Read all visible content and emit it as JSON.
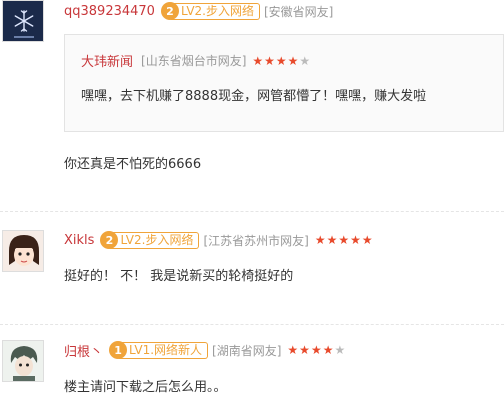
{
  "comments": [
    {
      "username": "qq389234470",
      "level_num": "2",
      "level_label": "LV2.步入网络",
      "location": "[安徽省网友]",
      "quote": {
        "username": "大玮新闻",
        "location": "[山东省烟台市网友]",
        "stars": "4 of 5",
        "text": "嘿嘿，去下机赚了8888现金，网管都懵了！嘿嘿，赚大发啦"
      },
      "text": "你还真是不怕死的6666"
    },
    {
      "username": "Xikls",
      "level_num": "2",
      "level_label": "LV2.步入网络",
      "location": "[江苏省苏州市网友]",
      "stars": "5 of 5",
      "text": "挺好的！ 不！ 我是说新买的轮椅挺好的"
    },
    {
      "username": "归根丶",
      "level_num": "1",
      "level_label": "LV1.网络新人",
      "location": "[湖南省网友]",
      "stars": "4 of 5",
      "text": "楼主请问下载之后怎么用。。"
    }
  ],
  "colors": {
    "username": "#c8373a",
    "level_orange": "#f0a43a",
    "star_on": "#e84a2c",
    "star_off": "#bbbbbb"
  }
}
